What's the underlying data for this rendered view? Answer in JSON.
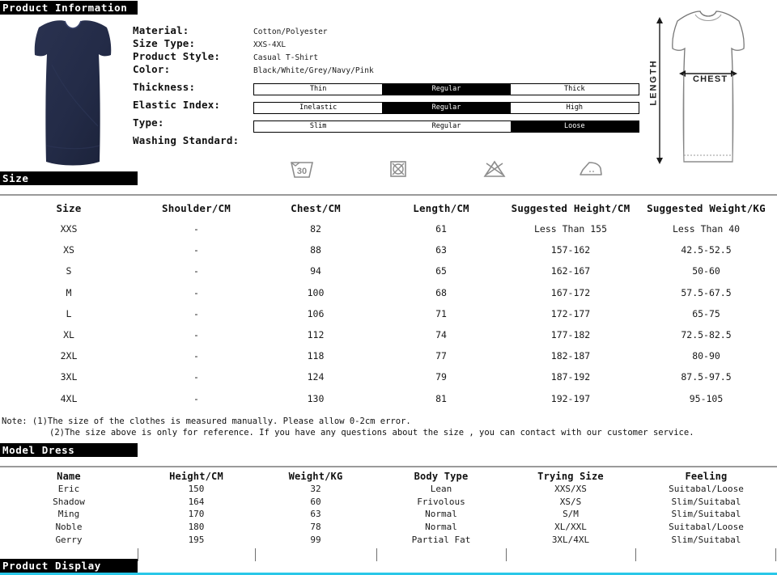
{
  "sections": {
    "product_information": "Product Information",
    "size": "Size",
    "model_dress": "Model Dress",
    "product_display": "Product Display"
  },
  "colors": {
    "header_bar_bg": "#000000",
    "header_bar_text": "#ffffff",
    "garment_navy": "#232b47",
    "rule_grey": "#9a9a9a",
    "accent_cyan": "#29c7e8"
  },
  "specs": {
    "labels": {
      "material": "Material:",
      "size_type": "Size Type:",
      "product_style": "Product Style:",
      "color": "Color:",
      "thickness": "Thickness:",
      "elastic_index": "Elastic Index:",
      "type": "Type:",
      "washing_standard": "Washing Standard:"
    },
    "values": {
      "material": "Cotton/Polyester",
      "size_type": "XXS-4XL",
      "product_style": "Casual T-Shirt",
      "color": "Black/White/Grey/Navy/Pink"
    },
    "thickness_options": [
      {
        "label": "Thin",
        "selected": false
      },
      {
        "label": "Regular",
        "selected": true
      },
      {
        "label": "Thick",
        "selected": false
      }
    ],
    "elastic_options": [
      {
        "label": "Inelastic",
        "selected": false
      },
      {
        "label": "Regular",
        "selected": true
      },
      {
        "label": "High",
        "selected": false
      }
    ],
    "type_options": [
      {
        "label": "Slim",
        "selected": false
      },
      {
        "label": "Regular",
        "selected": false
      },
      {
        "label": "Loose",
        "selected": true
      }
    ],
    "washing_icons": [
      "wash-30-degrees-icon",
      "do-not-tumble-dry-icon",
      "do-not-bleach-icon",
      "iron-icon"
    ],
    "wash_temperature": "30"
  },
  "diagram": {
    "length_label": "LENGTH",
    "chest_label": "CHEST"
  },
  "size_table": {
    "headers": [
      "Size",
      "Shoulder/CM",
      "Chest/CM",
      "Length/CM",
      "Suggested Height/CM",
      "Suggested Weight/KG"
    ],
    "rows": [
      [
        "XXS",
        "-",
        "82",
        "61",
        "Less Than 155",
        "Less Than 40"
      ],
      [
        "XS",
        "-",
        "88",
        "63",
        "157-162",
        "42.5-52.5"
      ],
      [
        "S",
        "-",
        "94",
        "65",
        "162-167",
        "50-60"
      ],
      [
        "M",
        "-",
        "100",
        "68",
        "167-172",
        "57.5-67.5"
      ],
      [
        "L",
        "-",
        "106",
        "71",
        "172-177",
        "65-75"
      ],
      [
        "XL",
        "-",
        "112",
        "74",
        "177-182",
        "72.5-82.5"
      ],
      [
        "2XL",
        "-",
        "118",
        "77",
        "182-187",
        "80-90"
      ],
      [
        "3XL",
        "-",
        "124",
        "79",
        "187-192",
        "87.5-97.5"
      ],
      [
        "4XL",
        "-",
        "130",
        "81",
        "192-197",
        "95-105"
      ]
    ],
    "note_line_1": "Note: (1)The size of the clothes is measured manually. Please allow 0-2cm error.",
    "note_line_2": "(2)The size above is only for reference. If you have any questions about the size , you can contact with our customer service."
  },
  "model_table": {
    "headers": [
      "Name",
      "Height/CM",
      "Weight/KG",
      "Body Type",
      "Trying Size",
      "Feeling"
    ],
    "rows": [
      [
        "Eric",
        "150",
        "32",
        "Lean",
        "XXS/XS",
        "Suitabal/Loose"
      ],
      [
        "Shadow",
        "164",
        "60",
        "Frivolous",
        "XS/S",
        "Slim/Suitabal"
      ],
      [
        "Ming",
        "170",
        "63",
        "Normal",
        "S/M",
        "Slim/Suitabal"
      ],
      [
        "Noble",
        "180",
        "78",
        "Normal",
        "XL/XXL",
        "Suitabal/Loose"
      ],
      [
        "Gerry",
        "195",
        "99",
        "Partial Fat",
        "3XL/4XL",
        "Slim/Suitabal"
      ]
    ]
  }
}
